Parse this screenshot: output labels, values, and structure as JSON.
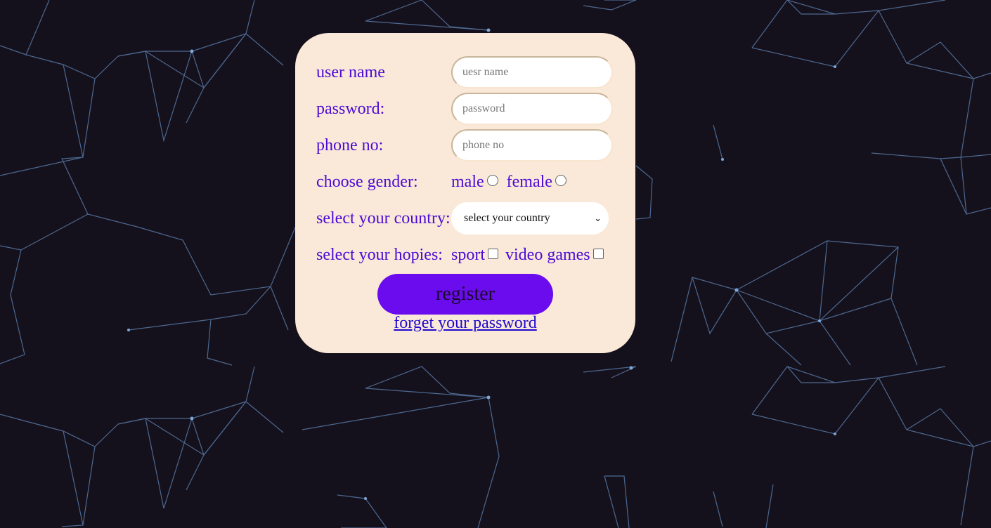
{
  "form": {
    "username": {
      "label": "user name",
      "placeholder": "uesr name"
    },
    "password": {
      "label": "password:",
      "placeholder": "password"
    },
    "phone": {
      "label": "phone no:",
      "placeholder": "phone no"
    },
    "gender": {
      "label": "choose gender:",
      "options": [
        "male",
        "female"
      ]
    },
    "country": {
      "label": "select your country:",
      "selected": "select your country"
    },
    "hobbies": {
      "label": "select your hopies:",
      "options": [
        "sport",
        "video games"
      ]
    },
    "register_label": "register",
    "forget_label": "forget your password"
  },
  "colors": {
    "background": "#15111c",
    "card": "#fae9d8",
    "label": "#4b0ad6",
    "button": "#6a0ced",
    "link": "#1f0ad0",
    "network_lines": "#5f86b8"
  },
  "icons": [
    "network-background",
    "chevron-down-icon"
  ]
}
